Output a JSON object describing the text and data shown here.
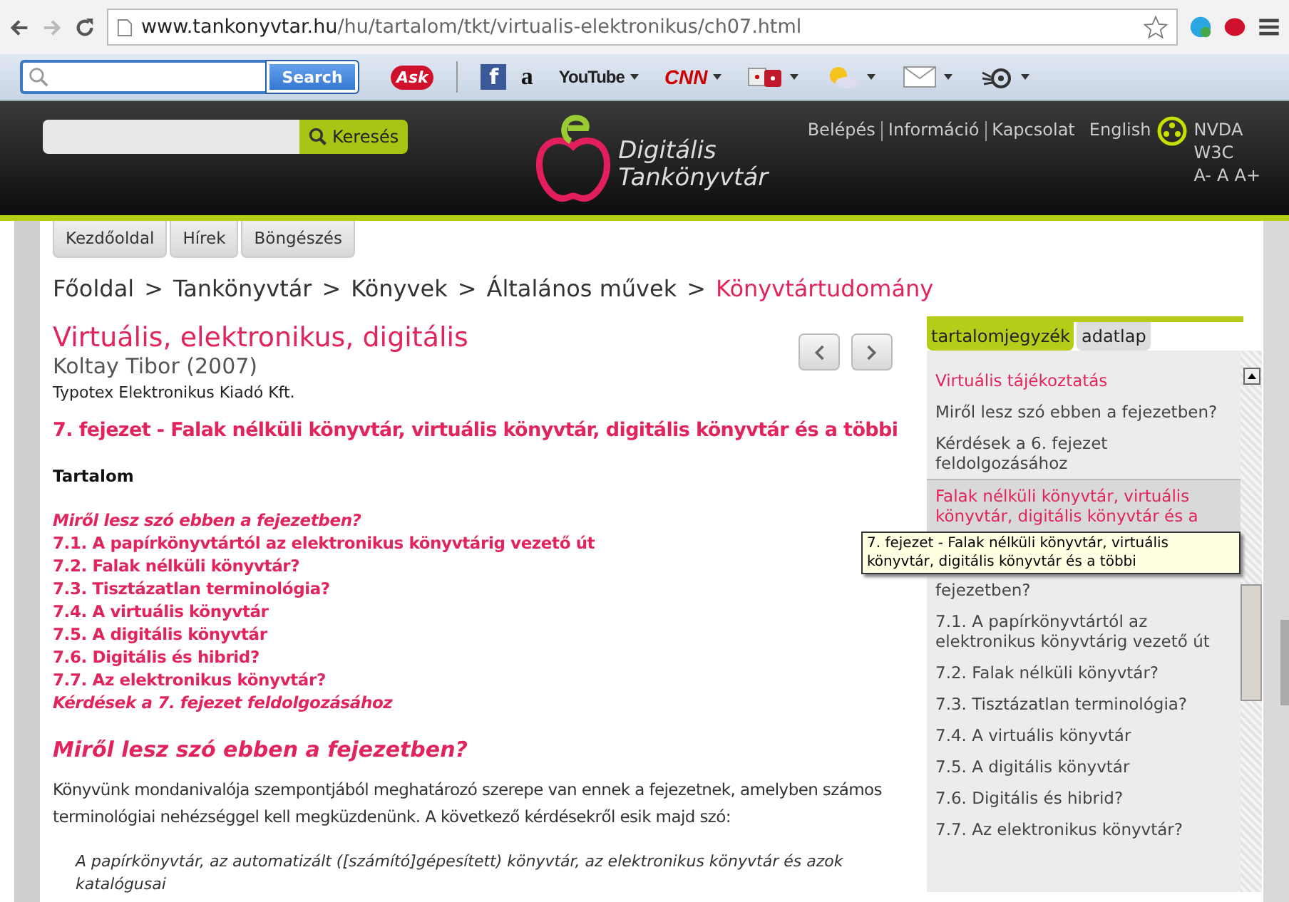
{
  "browser": {
    "url_host": "www.tankonyvtar.hu",
    "url_path": "/hu/tartalom/tkt/virtualis-elektronikus/ch07.html"
  },
  "toolbar": {
    "search_button": "Search",
    "ask": "Ask",
    "items": [
      {
        "kind": "facebook",
        "label": "f"
      },
      {
        "kind": "amazon",
        "label": "a"
      },
      {
        "kind": "youtube",
        "label": "YouTube"
      },
      {
        "kind": "cnn",
        "label": "CNN"
      },
      {
        "kind": "dice"
      },
      {
        "kind": "weather"
      },
      {
        "kind": "mail"
      },
      {
        "kind": "eye"
      }
    ]
  },
  "site_header": {
    "search_button": "Keresés",
    "logo_line1": "Digitális",
    "logo_line2": "Tankönyvtár",
    "links": [
      "Belépés",
      "Információ",
      "Kapcsolat"
    ],
    "language": "English",
    "access": [
      "NVDA",
      "W3C"
    ],
    "font_sizes": [
      "A-",
      "A",
      "A+"
    ]
  },
  "nav_tabs": [
    {
      "label": "Kezdőoldal"
    },
    {
      "label": "Hírek"
    },
    {
      "label": "Böngészés"
    }
  ],
  "breadcrumb": [
    {
      "kind": "link",
      "label": "Főoldal",
      "current": false
    },
    {
      "kind": "separator",
      "label": ">"
    },
    {
      "kind": "link",
      "label": "Tankönyvtár",
      "current": false
    },
    {
      "kind": "separator",
      "label": ">"
    },
    {
      "kind": "link",
      "label": "Könyvek",
      "current": false
    },
    {
      "kind": "separator",
      "label": ">"
    },
    {
      "kind": "link",
      "label": "Általános művek",
      "current": false
    },
    {
      "kind": "separator",
      "label": ">"
    },
    {
      "kind": "link",
      "label": "Könyvtártudomány",
      "current": true
    }
  ],
  "book": {
    "title": "Virtuális, elektronikus, digitális",
    "author": "Koltay Tibor (2007)",
    "publisher": "Typotex Elektronikus Kiadó Kft.",
    "chapter": "7. fejezet - Falak nélküli könyvtár, virtuális könyvtár, digitális könyvtár és a többi"
  },
  "contents": {
    "heading": "Tartalom",
    "links": [
      {
        "label": "Miről lesz szó ebben a fejezetben?",
        "kind": "italic"
      },
      {
        "label": "7.1. A papírkönyvtártól az elektronikus könyvtárig vezető út",
        "kind": "section"
      },
      {
        "label": "7.2. Falak nélküli könyvtár?",
        "kind": "section"
      },
      {
        "label": "7.3. Tisztázatlan terminológia?",
        "kind": "section"
      },
      {
        "label": "7.4. A virtuális könyvtár",
        "kind": "section"
      },
      {
        "label": "7.5. A digitális könyvtár",
        "kind": "section"
      },
      {
        "label": "7.6. Digitális és hibrid?",
        "kind": "section"
      },
      {
        "label": "7.7. Az elektronikus könyvtár?",
        "kind": "section"
      },
      {
        "label": "Kérdések a 7. fejezet feldolgozásához",
        "kind": "italic"
      }
    ]
  },
  "section": {
    "heading": "Miről lesz szó ebben a fejezetben?",
    "paragraph": "Könyvünk mondanivalója szempontjából meghatározó szerepe van ennek a fejezetnek, amelyben számos terminológiai nehézséggel kell megküzdenünk. A következő kérdésekről esik majd szó:",
    "quote": "A papírkönyvtár, az automatizált ([számító]gépesített) könyvtár, az elektronikus könyvtár és azok katalógusai"
  },
  "sidebar": {
    "tabs": [
      {
        "label": "tartalomjegyzék",
        "selected": true
      },
      {
        "label": "adatlap",
        "selected": false
      }
    ],
    "items": [
      {
        "label": "Virtuális tájékoztatás",
        "kind": "chapter",
        "selected": false
      },
      {
        "label": "Miről lesz szó ebben a fejezetben?",
        "kind": "entry",
        "selected": false
      },
      {
        "label": "Kérdések a 6. fejezet feldolgozásához",
        "kind": "entry",
        "selected": false
      },
      {
        "label": "Falak nélküli könyvtár, virtuális könyvtár, digitális könyvtár és a",
        "kind": "chapter",
        "selected": true
      },
      {
        "label": "fejezetben?",
        "kind": "entry",
        "selected": false
      },
      {
        "label": "7.1. A papírkönyvtártól az elektronikus könyvtárig vezető út",
        "kind": "entry",
        "selected": false
      },
      {
        "label": "7.2. Falak nélküli könyvtár?",
        "kind": "entry",
        "selected": false
      },
      {
        "label": "7.3. Tisztázatlan terminológia?",
        "kind": "entry",
        "selected": false
      },
      {
        "label": "7.4. A virtuális könyvtár",
        "kind": "entry",
        "selected": false
      },
      {
        "label": "7.5. A digitális könyvtár",
        "kind": "entry",
        "selected": false
      },
      {
        "label": "7.6. Digitális és hibrid?",
        "kind": "entry",
        "selected": false
      },
      {
        "label": "7.7. Az elektronikus könyvtár?",
        "kind": "entry",
        "selected": false
      }
    ],
    "tooltip": "7. fejezet - Falak nélküli könyvtár, virtuális könyvtár, digitális könyvtár és a többi"
  }
}
